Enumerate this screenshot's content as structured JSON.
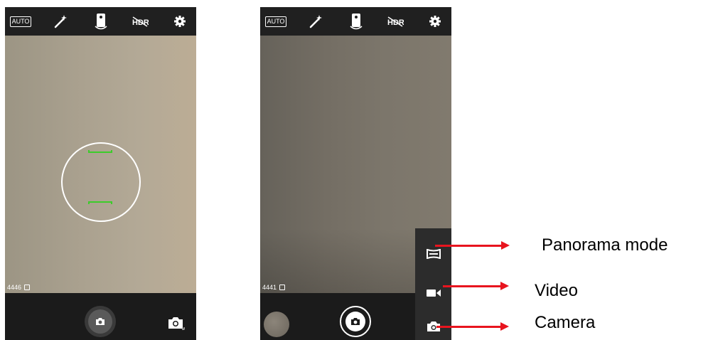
{
  "screens": [
    {
      "topbar": {
        "auto_label": "AUTO",
        "icons": [
          "magic-wand-icon",
          "flash-phone-icon",
          "hdr-off-icon",
          "settings-gear-icon"
        ]
      },
      "photo_count": "4446",
      "focus_indicator": true,
      "bottombar": {
        "shutter_icon": "camera-icon",
        "mode_icon": "camera-icon"
      }
    },
    {
      "topbar": {
        "auto_label": "AUTO",
        "icons": [
          "magic-wand-icon",
          "flash-phone-icon",
          "hdr-off-icon",
          "settings-gear-icon"
        ]
      },
      "photo_count": "4441",
      "bottombar": {
        "thumbnail": "last-photo-thumbnail",
        "shutter_icon": "camera-icon"
      },
      "mode_menu": [
        "panorama-icon",
        "video-camera-icon",
        "camera-icon"
      ]
    }
  ],
  "annotations": [
    {
      "label": "Panorama mode"
    },
    {
      "label": "Video"
    },
    {
      "label": "Camera"
    }
  ],
  "colors": {
    "topbar": "#202020",
    "bottombar": "#1b1b1b",
    "mode_panel": "#2c2c2c",
    "focus_marks": "#3ccc2a",
    "arrow": "#e8141e"
  }
}
